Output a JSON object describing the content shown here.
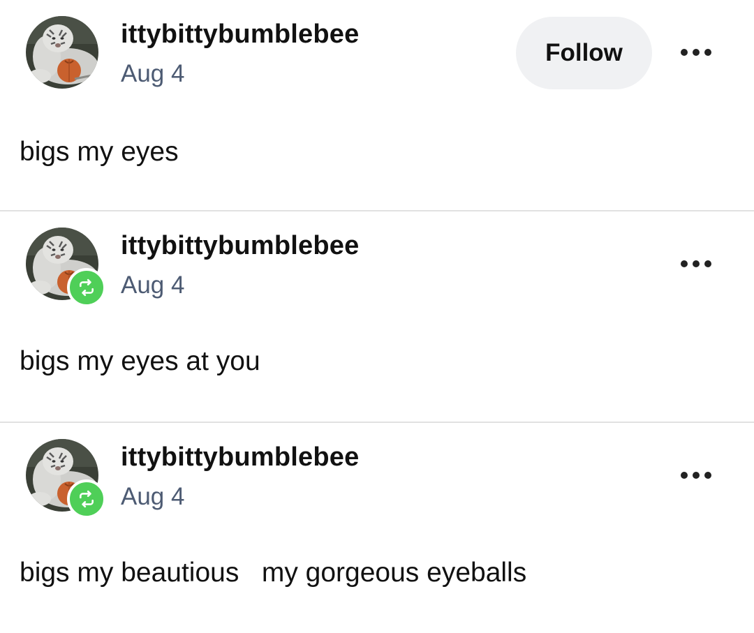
{
  "colors": {
    "background": "#ffffff",
    "username": "#111111",
    "date": "#4d5b73",
    "follow_button_bg": "#f0f1f3",
    "reblog_badge": "#4fcf58",
    "divider": "#e1e1e1"
  },
  "posts": [
    {
      "username": "ittybittybumblebee",
      "date": "Aug 4",
      "follow_label": "Follow",
      "avatar_icon": "white-tiger-avatar",
      "text": "bigs my eyes"
    },
    {
      "username": "ittybittybumblebee",
      "date": "Aug 4",
      "reblog_icon": "reblog-icon",
      "avatar_icon": "white-tiger-avatar",
      "text": "bigs my eyes at you"
    },
    {
      "username": "ittybittybumblebee",
      "date": "Aug 4",
      "reblog_icon": "reblog-icon",
      "avatar_icon": "white-tiger-avatar",
      "text": "bigs my beautious   my gorgeous eyeballs"
    }
  ]
}
